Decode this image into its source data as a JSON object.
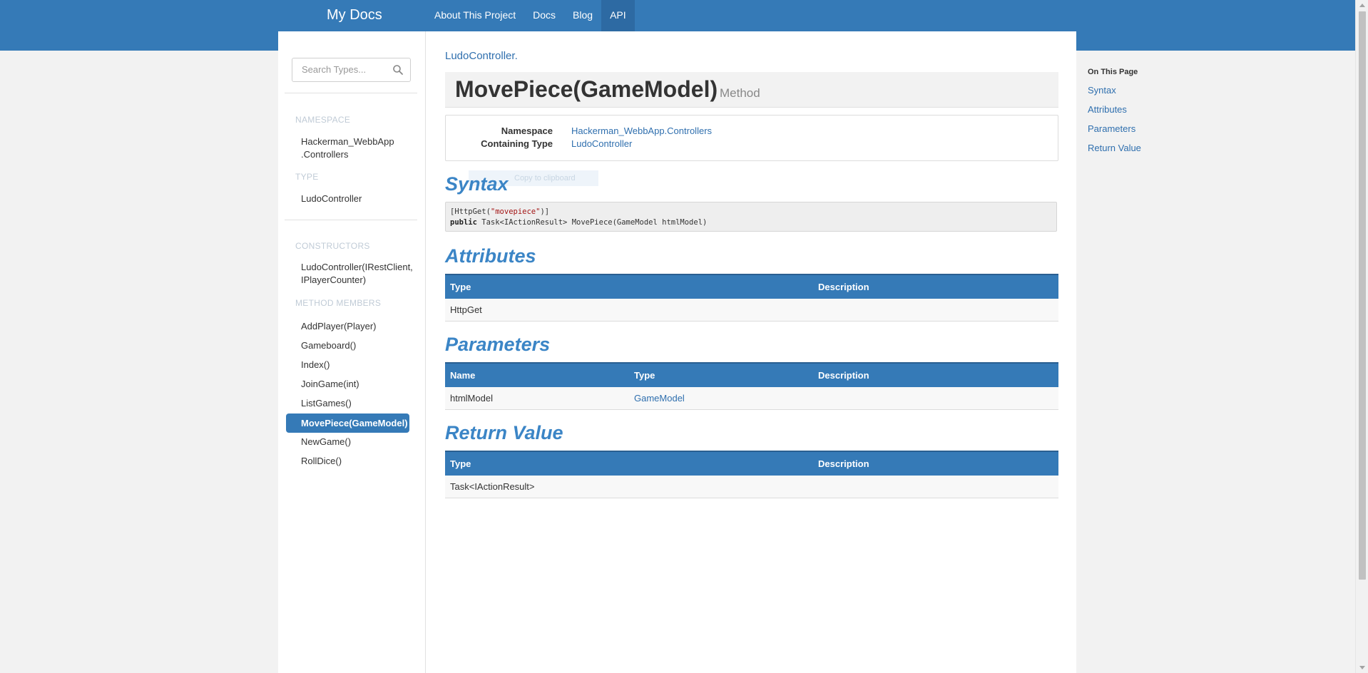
{
  "header": {
    "brand": "My Docs",
    "nav": [
      {
        "label": "About This Project"
      },
      {
        "label": "Docs"
      },
      {
        "label": "Blog"
      },
      {
        "label": "API"
      }
    ]
  },
  "sidebar": {
    "search": {
      "placeholder": "Search Types..."
    },
    "namespace_label": "NAMESPACE",
    "namespace_value_line1": "Hackerman_WebbApp",
    "namespace_value_line2": ".Controllers",
    "type_label": "TYPE",
    "type_value": "LudoController",
    "constructors_label": "CONSTRUCTORS",
    "constructor_line1": "LudoController(IRestClient,",
    "constructor_line2": "IPlayerCounter)",
    "methods_label": "METHOD MEMBERS",
    "methods": [
      {
        "label": "AddPlayer(Player)"
      },
      {
        "label": "Gameboard()"
      },
      {
        "label": "Index()"
      },
      {
        "label": "JoinGame(int)"
      },
      {
        "label": "ListGames()"
      },
      {
        "label": "MovePiece(GameModel)"
      },
      {
        "label": "NewGame()"
      },
      {
        "label": "RollDice()"
      }
    ]
  },
  "main": {
    "breadcrumb": "LudoController.",
    "title": "MovePiece(GameModel)",
    "kind": "Method",
    "info": {
      "namespace_label": "Namespace",
      "namespace_value": "Hackerman_WebbApp.Controllers",
      "containing_label": "Containing Type",
      "containing_value": "LudoController"
    },
    "faded_tip": "Copy to clipboard",
    "syntax_heading": "Syntax",
    "code": {
      "line1_a": "[HttpGet(",
      "line1_str": "\"movepiece\"",
      "line1_b": ")]",
      "line2_kw": "public",
      "line2_rest": " Task<IActionResult> MovePiece(GameModel htmlModel)"
    },
    "attributes_heading": "Attributes",
    "attributes": {
      "headers": [
        "Type",
        "Description"
      ],
      "rows": [
        [
          "HttpGet",
          ""
        ]
      ]
    },
    "parameters_heading": "Parameters",
    "parameters": {
      "headers": [
        "Name",
        "Type",
        "Description"
      ],
      "rows": [
        [
          "htmlModel",
          "GameModel",
          ""
        ]
      ]
    },
    "return_heading": "Return Value",
    "returns": {
      "headers": [
        "Type",
        "Description"
      ],
      "rows": [
        [
          "Task<IActionResult>",
          ""
        ]
      ]
    }
  },
  "toc": {
    "title": "On This Page",
    "items": [
      {
        "label": "Syntax"
      },
      {
        "label": "Attributes"
      },
      {
        "label": "Parameters"
      },
      {
        "label": "Return Value"
      }
    ]
  }
}
